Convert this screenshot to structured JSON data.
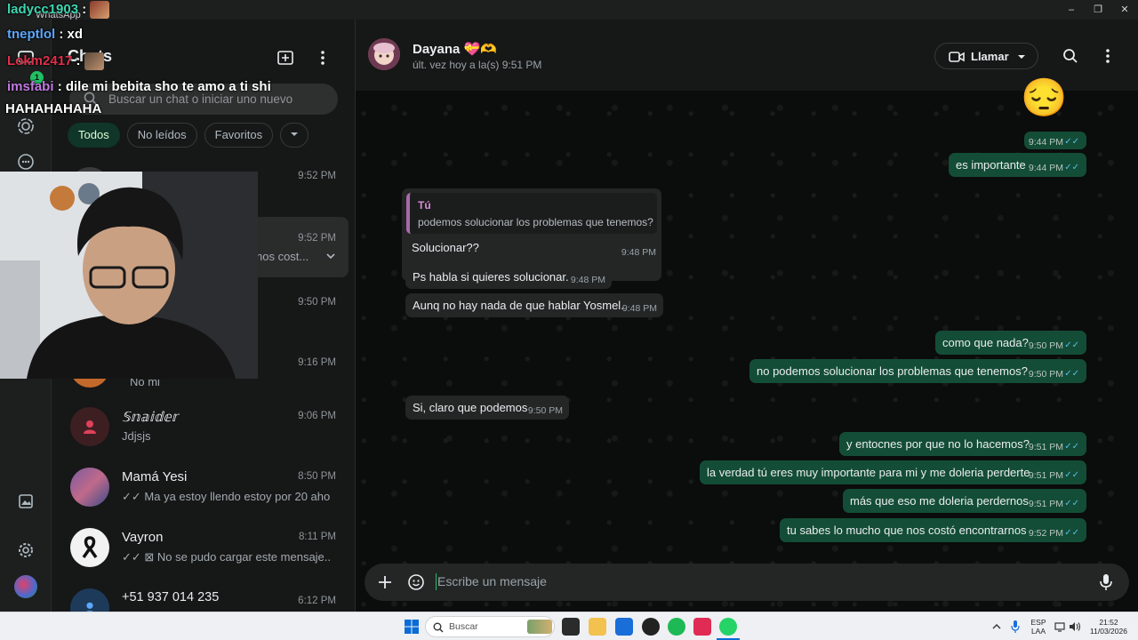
{
  "window": {
    "app_title": "WhatsApp",
    "min": "–",
    "restore": "❐",
    "close": "✕"
  },
  "chatlist": {
    "title": "Chats",
    "search_placeholder": "Buscar un chat o iniciar uno nuevo",
    "filters": [
      "Todos",
      "No leídos",
      "Favoritos"
    ],
    "rail_badge": "1",
    "chats": [
      {
        "name": "",
        "time": "9:52 PM",
        "last": ""
      },
      {
        "name": "",
        "time": "9:52 PM",
        "last": "nos cost..."
      },
      {
        "name": "",
        "time": "9:50 PM",
        "last": ""
      },
      {
        "name": "",
        "time": "9:16 PM",
        "last": "No mi"
      },
      {
        "name": "𝕊𝕟𝕒𝕚𝕕𝕖𝕣",
        "time": "9:06 PM",
        "last": "Jdjsjs"
      },
      {
        "name": "Mamá Yesi",
        "time": "8:50 PM",
        "last": "✓✓ Ma ya estoy llendo estoy por 20 aho..."
      },
      {
        "name": "Vayron",
        "time": "8:11 PM",
        "last": "✓✓ ⊠ No se pudo cargar este mensaje..."
      },
      {
        "name": "+51 937 014 235",
        "time": "6:12 PM",
        "last": ""
      }
    ]
  },
  "conversation": {
    "contact_name": "Dayana 💝🫶",
    "status": "últ. vez hoy a la(s) 9:51 PM",
    "call_label": "Llamar",
    "emoji_big": "😔",
    "quote": {
      "author": "Tú",
      "text": "podemos solucionar los problemas que tenemos?"
    },
    "messages": [
      {
        "dir": "out",
        "text": "",
        "time": "9:44 PM"
      },
      {
        "dir": "out",
        "text": "es importante",
        "time": "9:44 PM"
      },
      {
        "dir": "in",
        "text": "Solucionar??",
        "time": "9:48 PM"
      },
      {
        "dir": "in",
        "text": "Ps habla si quieres solucionar.",
        "time": "9:48 PM"
      },
      {
        "dir": "in",
        "text": "Aunq no hay nada de que hablar Yosmel.",
        "time": "9:48 PM"
      },
      {
        "dir": "out",
        "text": "como que nada?",
        "time": "9:50 PM"
      },
      {
        "dir": "out",
        "text": "no podemos solucionar los problemas que tenemos?",
        "time": "9:50 PM"
      },
      {
        "dir": "in",
        "text": "Si, claro que podemos",
        "time": "9:50 PM"
      },
      {
        "dir": "out",
        "text": "y entocnes por que no lo hacemos?",
        "time": "9:51 PM"
      },
      {
        "dir": "out",
        "text": "la verdad tú eres muy importante para mi y me doleria perderte",
        "time": "9:51 PM"
      },
      {
        "dir": "out",
        "text": "más que eso me doleria perdernos",
        "time": "9:51 PM"
      },
      {
        "dir": "out",
        "text": "tu sabes lo mucho que nos costó encontrarnos",
        "time": "9:52 PM"
      }
    ],
    "composer_placeholder": "Escribe un mensaje"
  },
  "stream_chat": [
    {
      "user": "ladycc1903",
      "user_color": "#3dd6b0",
      "msg": ":"
    },
    {
      "user": "tneptlol",
      "user_color": "#5aa8ff",
      "msg": ": xd"
    },
    {
      "user": "Lokm2417",
      "user_color": "#e0304a",
      "msg": ":"
    },
    {
      "user": "imsfabi",
      "user_color": "#c07ae0",
      "msg": ": dile mi bebita sho te amo a ti shi"
    },
    {
      "user": "",
      "user_color": "#ffffff",
      "msg": "HAHAHAHAHA"
    }
  ],
  "taskbar": {
    "search_placeholder": "Buscar",
    "lang1": "ESP",
    "lang2": "LAA",
    "clock_time": "21:52",
    "clock_date": "11/03/2026"
  }
}
